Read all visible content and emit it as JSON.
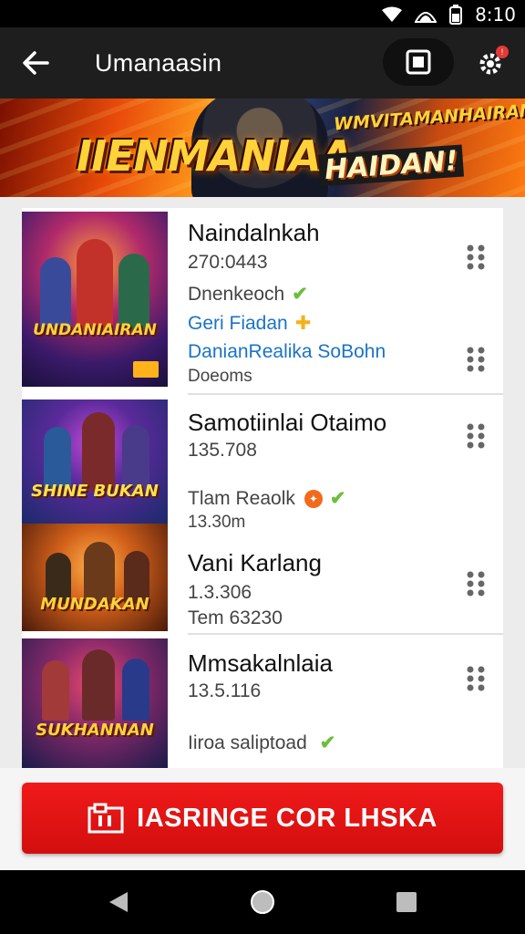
{
  "status_bar": {
    "time": "8:10"
  },
  "app_bar": {
    "title": "Umanaasin"
  },
  "banner": {
    "title": "IIENMANIAA",
    "subtitle": "WMVITAMANHAIRAN",
    "tag": "HAIDAN!"
  },
  "items": [
    {
      "title": "Naindalnkah",
      "meta": "270:0443",
      "line1": "Dnenkeoch",
      "line2": "Geri Fiadan",
      "link": "DanianRealika SoBohn",
      "line3": "Doeoms",
      "thumb_text": "UNDANIAIRAN"
    },
    {
      "title": "Samotiinlai Otaimo",
      "meta": "135.708",
      "line1": "Tlam Reaolk",
      "line2": "13.30m",
      "thumb_text": "SHINE BUKAN"
    },
    {
      "title": "Vani Karlang",
      "meta": "1.3.306",
      "line1": "Tem 63230",
      "thumb_text": "MUNDAKAN"
    },
    {
      "title": "Mmsakalnlaia",
      "meta": "13.5.116",
      "line1": "Iiroa saliptoad",
      "thumb_text": "SUKHANNAN"
    }
  ],
  "cta": {
    "label": "IASRINGE COR LHSKA"
  },
  "colors": {
    "accent": "#e31414",
    "link": "#1a73c8",
    "check": "#6bbf3a"
  }
}
